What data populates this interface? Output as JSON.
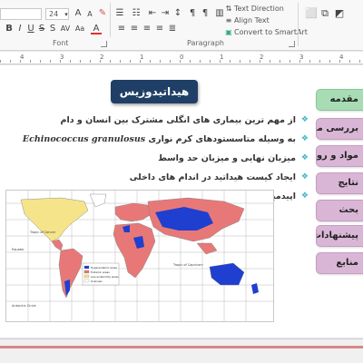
{
  "ribbon": {
    "font_size": "24",
    "groups": {
      "font": "Font",
      "paragraph": "Paragraph"
    },
    "paragraph": {
      "text_direction": "Text Direction",
      "align_text": "Align Text",
      "smartart": "Convert to SmartArt"
    }
  },
  "ruler": {
    "numbers": [
      "4",
      "3",
      "2",
      "1",
      "0",
      "1",
      "2",
      "3",
      "4"
    ]
  },
  "slide": {
    "title": "هیداتیدوزیس",
    "bullets": [
      {
        "text": "از مهم ترین بیماری های انگلی مشترک بین انسان و دام"
      },
      {
        "prefix": "به وسیله متاسستودهای کرم نواری",
        "latin": "Echinococcus granulosus"
      },
      {
        "text": "میزبان نهایی و میزبان حد واسط"
      },
      {
        "text": "ایجاد کیست هیداتید در اندام های داخلی"
      },
      {
        "text": "اپیدمیولوژی"
      }
    ],
    "nav_buttons": [
      {
        "label": "مقدمه",
        "active": true
      },
      {
        "label": "بررسی منابع",
        "active": false
      },
      {
        "label": "مواد و روشها",
        "active": false
      },
      {
        "label": "نتایج",
        "active": false
      },
      {
        "label": "بحث",
        "active": false
      },
      {
        "label": "پیشنهادات",
        "active": false
      },
      {
        "label": "منابع",
        "active": false
      }
    ],
    "map": {
      "colors": {
        "hyperendemic": "#1f3fd0",
        "endemic": "#e87878",
        "low_sporadic": "#f5e48a",
        "unknown": "#ffffff",
        "ocean": "#ffffff",
        "grid": "#a8a8a8"
      },
      "labels": {
        "cancer": "Tropic of Cancer",
        "equator": "Equator",
        "capricorn": "Tropic of Capricorn",
        "antarctic": "Antarctic Circle"
      },
      "legend": [
        {
          "key": "hyperendemic",
          "label": "Hyperendemic areas"
        },
        {
          "key": "endemic",
          "label": "Endemic areas"
        },
        {
          "key": "low_sporadic",
          "label": "Low endemicity areas"
        },
        {
          "key": "unknown",
          "label": "Unknown"
        }
      ]
    }
  },
  "colors": {
    "title_bg": "#1f3f66",
    "nav_bg": "#dab6d6",
    "nav_active_bg": "#a8dcb5",
    "bullet_marker": "#3fb6c8"
  }
}
